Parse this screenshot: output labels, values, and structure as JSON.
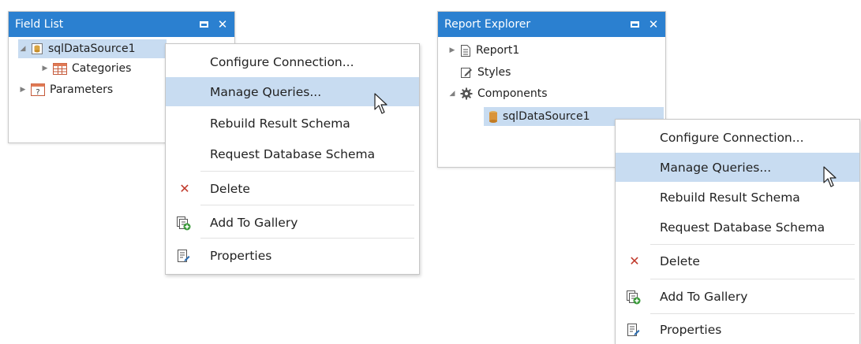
{
  "field_list": {
    "title": "Field List",
    "items": [
      {
        "label": "sqlDataSource1",
        "icon": "datasource-icon"
      },
      {
        "label": "Categories",
        "icon": "table-icon"
      },
      {
        "label": "Parameters",
        "icon": "parameters-icon"
      }
    ]
  },
  "menu_left": {
    "items": [
      {
        "label": "Configure Connection..."
      },
      {
        "label": "Manage Queries..."
      },
      {
        "label": "Rebuild Result Schema"
      },
      {
        "label": "Request Database Schema"
      },
      {
        "label": "Delete",
        "icon": "delete-icon"
      },
      {
        "label": "Add To Gallery",
        "icon": "add-to-gallery-icon"
      },
      {
        "label": "Properties",
        "icon": "properties-icon"
      }
    ]
  },
  "report_explorer": {
    "title": "Report Explorer",
    "items": [
      {
        "label": "Report1",
        "icon": "report-icon"
      },
      {
        "label": "Styles",
        "icon": "styles-icon"
      },
      {
        "label": "Components",
        "icon": "gear-icon"
      },
      {
        "label": "sqlDataSource1",
        "icon": "database-icon"
      }
    ]
  },
  "menu_right": {
    "items": [
      {
        "label": "Configure Connection..."
      },
      {
        "label": "Manage Queries..."
      },
      {
        "label": "Rebuild Result Schema"
      },
      {
        "label": "Request Database Schema"
      },
      {
        "label": "Delete",
        "icon": "delete-icon"
      },
      {
        "label": "Add To Gallery",
        "icon": "add-to-gallery-icon"
      },
      {
        "label": "Properties",
        "icon": "properties-icon"
      }
    ]
  },
  "colors": {
    "header": "#2b80d0",
    "selection": "#c8dcf1",
    "delete": "#c0392b"
  }
}
